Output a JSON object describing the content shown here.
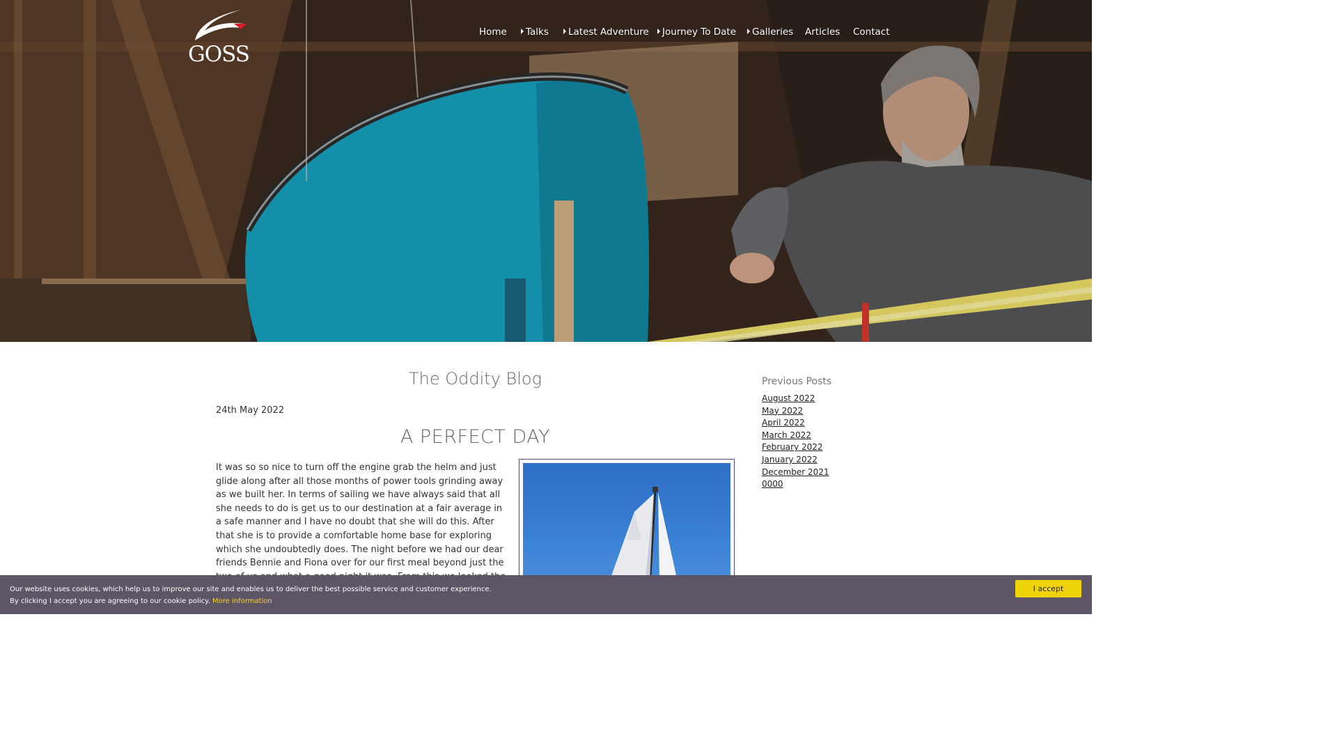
{
  "logo": {
    "text": "GOSS"
  },
  "nav": {
    "items": [
      {
        "label": "Home",
        "has_submenu": false
      },
      {
        "label": "Talks",
        "has_submenu": true
      },
      {
        "label": "Latest Adventure",
        "has_submenu": true
      },
      {
        "label": "Journey To Date",
        "has_submenu": true
      },
      {
        "label": "Galleries",
        "has_submenu": true
      },
      {
        "label": "Articles",
        "has_submenu": false
      },
      {
        "label": "Contact",
        "has_submenu": false
      }
    ]
  },
  "blog": {
    "title": "The Oddity Blog",
    "post": {
      "date": "24th May 2022",
      "title": "A PERFECT DAY",
      "body": " It was so so nice to turn off the engine grab the helm and just glide along after all those months of power tools grinding away as we built her. In terms of sailing we have always said that all she needs to do is get us to our destination at a fair average in a safe manner and I have no doubt that she will do this. After that she is to provide a comfortable home base for exploring which she undoubtedly does. The night before we had our dear friends Bennie and Fiona over for our first meal beyond just the two of us and what a good night it was. From this we looked the at weather and reckon the moment"
    }
  },
  "sidebar": {
    "title": "Previous Posts",
    "links": [
      "August 2022",
      "May 2022",
      "April 2022",
      "March 2022",
      "February 2022",
      "January 2022",
      "December 2021",
      "0000"
    ]
  },
  "cookie": {
    "line1": "Our website uses cookies, which help us to improve our site and enables us to deliver the best possible service and customer experience.",
    "line2": "By clicking I accept you are agreeing to our cookie policy.",
    "more_info": "More information",
    "accept_label": "I accept"
  },
  "colors": {
    "cookie_bar": "#5e5567",
    "accept_button": "#f0d40b",
    "more_info_link": "#f5d13a",
    "logo_accent": "#d6202a",
    "hull": "#1aa5c4"
  }
}
